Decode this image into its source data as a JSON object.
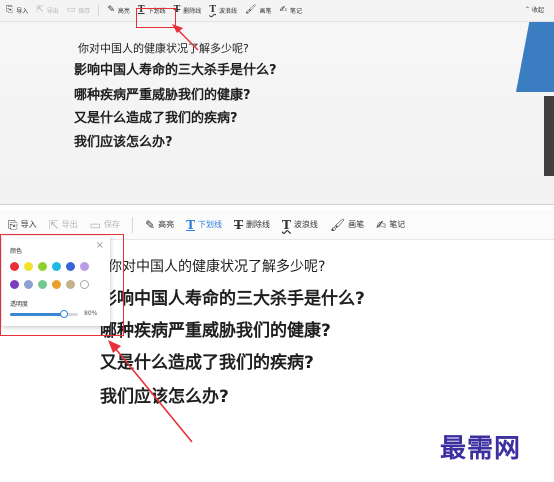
{
  "toolbar": {
    "import": "导入",
    "export": "导出",
    "save": "保存",
    "highlight": "高亮",
    "underline": "下划线",
    "strikethrough": "删除线",
    "wavy_line": "波浪线",
    "brush": "画笔",
    "note": "笔记",
    "collapse": "收起",
    "icons": {
      "import": "import-icon",
      "export": "export-icon",
      "save": "save-icon",
      "highlight": "pen-icon",
      "underline": "underline-t-icon",
      "strikethrough": "strikethrough-t-icon",
      "wavy_line": "wavy-t-icon",
      "brush": "brush-icon",
      "note": "note-icon",
      "collapse": "double-chevron-up-icon"
    }
  },
  "slide": {
    "line1": "你对中国人的健康状况了解多少呢?",
    "line2": "影响中国人寿命的三大杀手是什么?",
    "line3": "哪种疾病严重威胁我们的健康?",
    "line4": "又是什么造成了我们的疾病?",
    "line5": "我们应该怎么办?"
  },
  "color_popup": {
    "title": "颜色",
    "opacity_label": "透明度",
    "opacity_value": "80%",
    "opacity_fraction": 0.8,
    "colors": [
      "#e8303a",
      "#f2e22a",
      "#8fd12a",
      "#1fb9e6",
      "#3a63d6",
      "#b99be6",
      "#7a3fc0",
      "#8aa0d0",
      "#72c890",
      "#e9a030",
      "#c4b08a"
    ]
  },
  "watermark": "最需网",
  "colors": {
    "accent": "#2f7fd8",
    "annotation_red": "#e8303a",
    "slide_blue": "#3a7dc0"
  }
}
